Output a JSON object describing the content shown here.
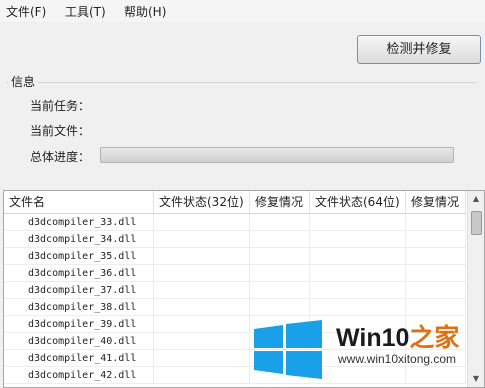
{
  "menu": [
    {
      "label": "文件(F)"
    },
    {
      "label": "工具(T)"
    },
    {
      "label": "帮助(H)"
    }
  ],
  "toolbar": {
    "check_repair_label": "检测并修复"
  },
  "info": {
    "group_title": "信息",
    "current_task_label": "当前任务：",
    "current_file_label": "当前文件：",
    "overall_progress_label": "总体进度：",
    "progress_value": 0
  },
  "table": {
    "columns": [
      "文件名",
      "文件状态(32位)",
      "修复情况",
      "文件状态(64位)",
      "修复情况"
    ],
    "rows": [
      "d3dcompiler_33.dll",
      "d3dcompiler_34.dll",
      "d3dcompiler_35.dll",
      "d3dcompiler_36.dll",
      "d3dcompiler_37.dll",
      "d3dcompiler_38.dll",
      "d3dcompiler_39.dll",
      "d3dcompiler_40.dll",
      "d3dcompiler_41.dll",
      "d3dcompiler_42.dll"
    ]
  },
  "watermark": {
    "brand": "Win10",
    "brand_suffix": "之家",
    "url": "www.win10xitong.com",
    "logo_color": "#1aa0e8",
    "accent_color": "#e07010"
  }
}
